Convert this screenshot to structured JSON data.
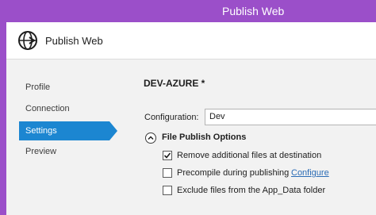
{
  "window": {
    "title": "Publish Web"
  },
  "header": {
    "title": "Publish Web",
    "icon": "globe-arrow-icon"
  },
  "nav": {
    "items": [
      {
        "label": "Profile",
        "selected": false
      },
      {
        "label": "Connection",
        "selected": false
      },
      {
        "label": "Settings",
        "selected": true
      },
      {
        "label": "Preview",
        "selected": false
      }
    ]
  },
  "content": {
    "profile_name": "DEV-AZURE *",
    "configuration_label": "Configuration:",
    "configuration_value": "Dev",
    "section_title": "File Publish Options",
    "options": [
      {
        "label": "Remove additional files at destination",
        "checked": true
      },
      {
        "label": "Precompile during publishing",
        "checked": false
      },
      {
        "label": "Exclude files from the App_Data folder",
        "checked": false
      }
    ],
    "configure_link": "Configure"
  },
  "colors": {
    "titlebar": "#9b4fc9",
    "selected_nav": "#1c86d1",
    "link": "#2b6cb5"
  }
}
